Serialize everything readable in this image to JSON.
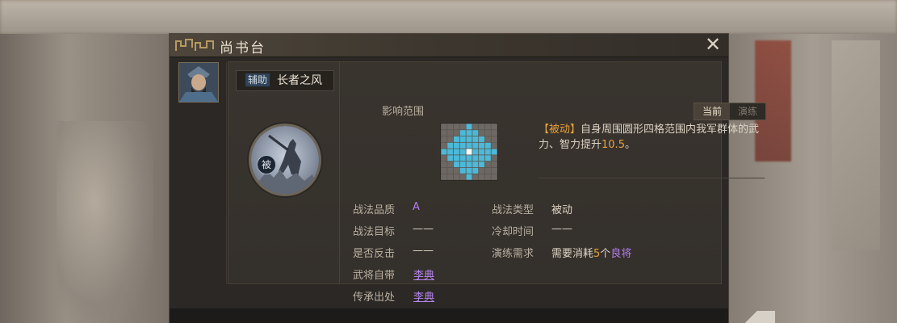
{
  "window": {
    "title": "尚书台"
  },
  "skill": {
    "tag": "辅助",
    "name": "长者之风",
    "badge": "被"
  },
  "range": {
    "label": "影响范围"
  },
  "tabs": [
    {
      "label": "当前",
      "active": true
    },
    {
      "label": "演练",
      "active": false
    }
  ],
  "description": {
    "tag": "【被动】",
    "text_prefix": "自身周围圆形四格范围内我军群体的武力、智力提升",
    "value": "10.5",
    "text_suffix": "。"
  },
  "stats": {
    "quality_label": "战法品质",
    "quality_value": "A",
    "target_label": "战法目标",
    "target_value": "——",
    "counter_label": "是否反击",
    "counter_value": "——",
    "general_label": "武将自带",
    "general_value": "李典",
    "inherit_label": "传承出处",
    "inherit_value": "李典",
    "type_label": "战法类型",
    "type_value": "被动",
    "cooldown_label": "冷却时间",
    "cooldown_value": "——",
    "practice_label": "演练需求",
    "practice_prefix": "需要消耗",
    "practice_count": "5",
    "practice_unit": "个",
    "practice_item": "良将"
  },
  "colors": {
    "accent_orange": "#e8a23c",
    "quality_purple": "#b57cf0",
    "range_cell": "#4cb9d8",
    "center_cell": "#ffffff"
  }
}
